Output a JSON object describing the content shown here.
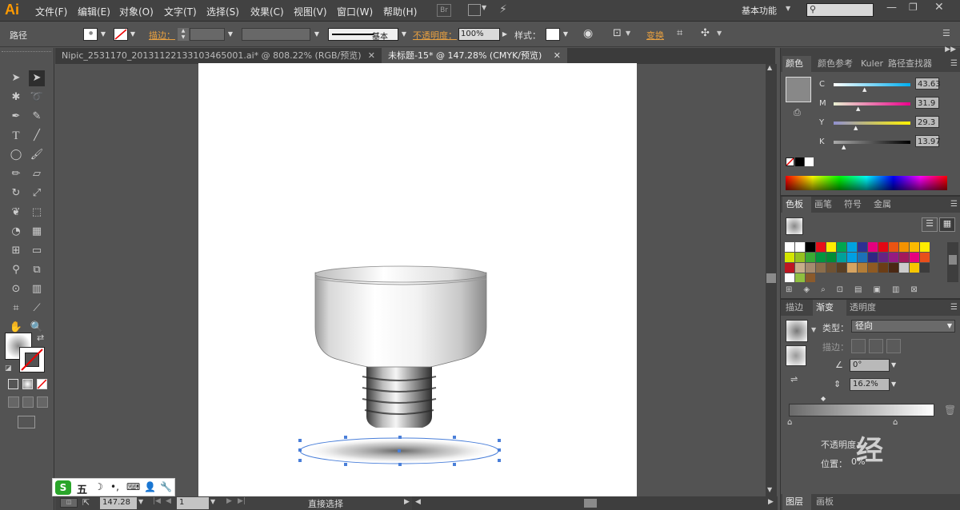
{
  "app": {
    "logo": "Ai",
    "workspace": "基本功能",
    "search_placeholder": ""
  },
  "menu": [
    "文件(F)",
    "编辑(E)",
    "对象(O)",
    "文字(T)",
    "选择(S)",
    "效果(C)",
    "视图(V)",
    "窗口(W)",
    "帮助(H)"
  ],
  "menu_extra": {
    "br": "Br"
  },
  "control": {
    "selection": "路径",
    "stroke_label": "描边：",
    "stroke_style": "基本",
    "opacity_label": "不透明度：",
    "opacity_value": "100%",
    "style_label": "样式：",
    "transform_label": "变换"
  },
  "doc_tabs": [
    {
      "label": "Nipic_2531170_20131122133103465001.ai* @ 808.22% (RGB/预览)",
      "active": false
    },
    {
      "label": "未标题-15* @ 147.28% (CMYK/预览)",
      "active": true
    }
  ],
  "status": {
    "zoom": "147.28",
    "page": "1",
    "tool": "直接选择"
  },
  "color_panel": {
    "tabs": [
      "颜色",
      "颜色参考",
      "Kuler",
      "路径查找器"
    ],
    "channels": [
      {
        "label": "C",
        "value": "43.63",
        "fill": 0.43
      },
      {
        "label": "M",
        "value": "31.9",
        "fill": 0.32
      },
      {
        "label": "Y",
        "value": "29.3",
        "fill": 0.29
      },
      {
        "label": "K",
        "value": "13.97",
        "fill": 0.14
      }
    ]
  },
  "swatch_panel": {
    "tabs": [
      "色板",
      "画笔",
      "符号",
      "金属"
    ]
  },
  "gradient_panel": {
    "tabs": [
      "描边",
      "渐变",
      "透明度"
    ],
    "type_label": "类型：",
    "type_value": "径向",
    "stroke_label": "描边：",
    "angle_value": "0°",
    "aspect_value": "16.2%",
    "opacity_label": "不透明度：",
    "location_label": "位置：",
    "location_value": "0%"
  },
  "bottom_tabs": [
    "图层",
    "画板"
  ],
  "ime": {
    "label": "五"
  },
  "colors": {
    "accent": "#ff9a00",
    "path_select": "#4a7fd9"
  }
}
